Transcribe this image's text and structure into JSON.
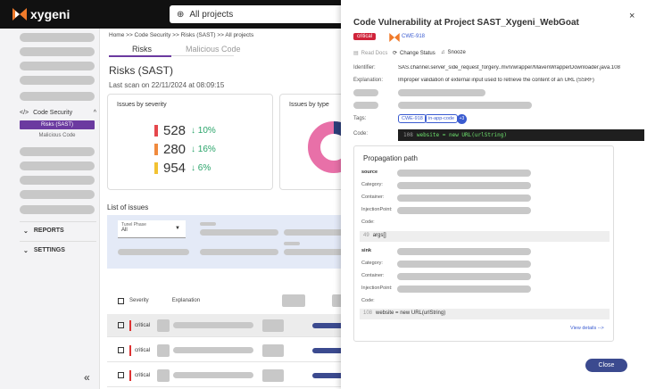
{
  "app": {
    "name": "xygeni",
    "project_selector": "All projects"
  },
  "sidebar": {
    "code_security": "Code Security",
    "risks": "Risks (SAST)",
    "malicious": "Malicious Code",
    "reports": "REPORTS",
    "settings": "SETTINGS",
    "collapse": "«"
  },
  "main": {
    "breadcrumb": "Home >> Code Security >> Risks (SAST) >> All projects",
    "tabs": [
      "Risks",
      "Malicious Code"
    ],
    "title": "Risks (SAST)",
    "last_scan": "Last scan on 22/11/2024 at 08:09:15",
    "severity_card_title": "Issues by severity",
    "type_card_title": "Issues by type",
    "severity": [
      {
        "count": "528",
        "pct": "↓ 10%",
        "color": "#e5484d"
      },
      {
        "count": "280",
        "pct": "↓ 16%",
        "color": "#f08a3e"
      },
      {
        "count": "954",
        "pct": "↓ 6%",
        "color": "#f2c232"
      }
    ],
    "list_title": "List of issues",
    "filter": {
      "label": "Tunel Phase",
      "value": "All"
    },
    "table_headers": {
      "severity": "Severity",
      "explanation": "Explanation"
    },
    "rows": [
      "critical",
      "critical",
      "critical"
    ]
  },
  "panel": {
    "title": "Code Vulnerability at Project SAST_Xygeni_WebGoat",
    "close": "×",
    "severity": "critical",
    "cwe": "CWE-918",
    "actions": {
      "read_docs": "Read Docs",
      "change_status": "Change Status",
      "snooze": "Snooze"
    },
    "identifier_label": "Identifier:",
    "identifier": "SAS.channel.server_side_request_forgery..mvn/wrapper/MavenWrapperDownloader.java.108",
    "explanation_label": "Explanation:",
    "explanation": "Improper validation of external input used to retrieve the content of an URL (SSRF)",
    "tags_label": "Tags:",
    "tags": [
      "CWE-918",
      "in-app-code",
      "+3"
    ],
    "code_label": "Code:",
    "code": {
      "line": "108",
      "text": "website = new URL(urlString)"
    },
    "propagation": {
      "title": "Propagation path",
      "source": "source",
      "sink": "sink",
      "category": "Category:",
      "container": "Container:",
      "injection_point": "InjectionPoint:",
      "code": "Code:",
      "source_code": {
        "line": "49",
        "text": "args[]"
      },
      "sink_code": {
        "line": "108",
        "text": "website = new URL(urlString)"
      },
      "view_details": "View details -->"
    },
    "close_button": "Close"
  },
  "colors": {
    "accent": "#6b3aa0",
    "button": "#3b4a8f",
    "critical": "#d0233a",
    "link": "#3a5bd0"
  }
}
